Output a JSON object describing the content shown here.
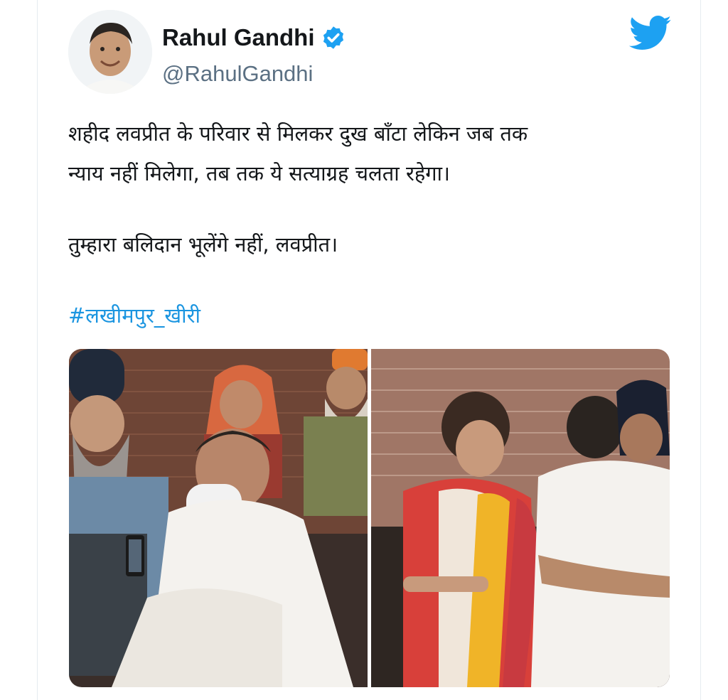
{
  "tweet": {
    "author": {
      "display_name": "Rahul Gandhi",
      "handle": "@RahulGandhi",
      "verified": true,
      "avatar_icon": "profile-photo"
    },
    "platform_icon": "twitter-bird-icon",
    "text_lines_para1": [
      "शहीद लवप्रीत के परिवार से मिलकर दुख बाँटा लेकिन जब तक",
      "न्याय नहीं मिलेगा, तब तक ये सत्याग्रह चलता रहेगा।"
    ],
    "text_para2": "तुम्हारा बलिदान भूलेंगे नहीं, लवप्रीत।",
    "hashtag": "#लखीमपुर_खीरी",
    "media": {
      "count": 2
    }
  },
  "colors": {
    "twitter_blue": "#1da1f2",
    "hashtag": "#1b95e0",
    "text": "#14171a",
    "secondary": "#5b7083"
  }
}
